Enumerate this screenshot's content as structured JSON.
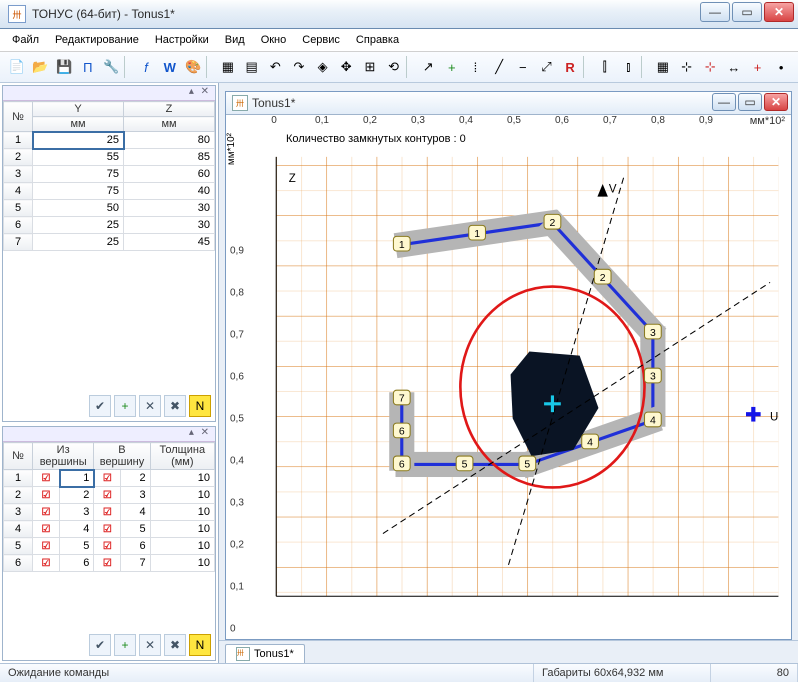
{
  "window": {
    "title": "ТОНУС (64-бит) - Tonus1*",
    "icon_text": "卅"
  },
  "menu": {
    "file": "Файл",
    "edit": "Редактирование",
    "settings": "Настройки",
    "view": "Вид",
    "window": "Окно",
    "service": "Сервис",
    "help": "Справка"
  },
  "table1": {
    "header": {
      "no": "№",
      "y": "Y",
      "z": "Z",
      "unit": "мм"
    },
    "rows": [
      {
        "n": "1",
        "y": "25",
        "z": "80"
      },
      {
        "n": "2",
        "y": "55",
        "z": "85"
      },
      {
        "n": "3",
        "y": "75",
        "z": "60"
      },
      {
        "n": "4",
        "y": "75",
        "z": "40"
      },
      {
        "n": "5",
        "y": "50",
        "z": "30"
      },
      {
        "n": "6",
        "y": "25",
        "z": "30"
      },
      {
        "n": "7",
        "y": "25",
        "z": "45"
      }
    ]
  },
  "table2": {
    "header": {
      "no": "№",
      "from": "Из вершины",
      "to": "В вершину",
      "thick": "Толщина (мм)"
    },
    "rows": [
      {
        "n": "1",
        "f": "1",
        "t": "2",
        "th": "10"
      },
      {
        "n": "2",
        "f": "2",
        "t": "3",
        "th": "10"
      },
      {
        "n": "3",
        "f": "3",
        "t": "4",
        "th": "10"
      },
      {
        "n": "4",
        "f": "4",
        "t": "5",
        "th": "10"
      },
      {
        "n": "5",
        "f": "5",
        "t": "6",
        "th": "10"
      },
      {
        "n": "6",
        "f": "6",
        "t": "7",
        "th": "10"
      }
    ]
  },
  "doc": {
    "title": "Tonus1*",
    "info": "Количество замкнутых контуров :  0",
    "tab": "Tonus1*",
    "xunit": "мм*10²",
    "yunit": "мм*10²"
  },
  "status": {
    "left": "Ожидание команды",
    "mid": "Габариты 60x64,932 мм",
    "right": "80"
  },
  "chart_data": {
    "type": "engineering-plot",
    "x_ticks": [
      0,
      0.1,
      0.2,
      0.3,
      0.4,
      0.5,
      0.6,
      0.7,
      0.8,
      0.9
    ],
    "y_ticks": [
      0,
      0.1,
      0.2,
      0.3,
      0.4,
      0.5,
      0.6,
      0.7,
      0.8,
      0.9
    ],
    "x_range": [
      0,
      1.0
    ],
    "y_range": [
      0,
      1.0
    ],
    "vertices": [
      {
        "id": 1,
        "y": 25,
        "z": 80
      },
      {
        "id": 2,
        "y": 55,
        "z": 85
      },
      {
        "id": 3,
        "y": 75,
        "z": 60
      },
      {
        "id": 4,
        "y": 75,
        "z": 40
      },
      {
        "id": 5,
        "y": 50,
        "z": 30
      },
      {
        "id": 6,
        "y": 25,
        "z": 30
      },
      {
        "id": 7,
        "y": 25,
        "z": 45
      }
    ],
    "segments": [
      {
        "id": 1,
        "from": 1,
        "to": 2,
        "thickness": 10
      },
      {
        "id": 2,
        "from": 2,
        "to": 3,
        "thickness": 10
      },
      {
        "id": 3,
        "from": 3,
        "to": 4,
        "thickness": 10
      },
      {
        "id": 4,
        "from": 4,
        "to": 5,
        "thickness": 10
      },
      {
        "id": 5,
        "from": 5,
        "to": 6,
        "thickness": 10
      },
      {
        "id": 6,
        "from": 6,
        "to": 7,
        "thickness": 10
      }
    ],
    "ellipse": {
      "cx": 0.55,
      "cy": 0.55,
      "rx": 0.18,
      "ry": 0.2
    },
    "axes_misc": [
      "U",
      "V",
      "Z"
    ]
  },
  "colors": {
    "grid": "#e08a2a",
    "segment_fill": "#b5b5b5",
    "segment_stroke": "#2030d8",
    "ellipse": "#e01818",
    "shape_fill": "#0a1424",
    "marker": "#18c8e8",
    "u_marker": "#1414e8"
  }
}
